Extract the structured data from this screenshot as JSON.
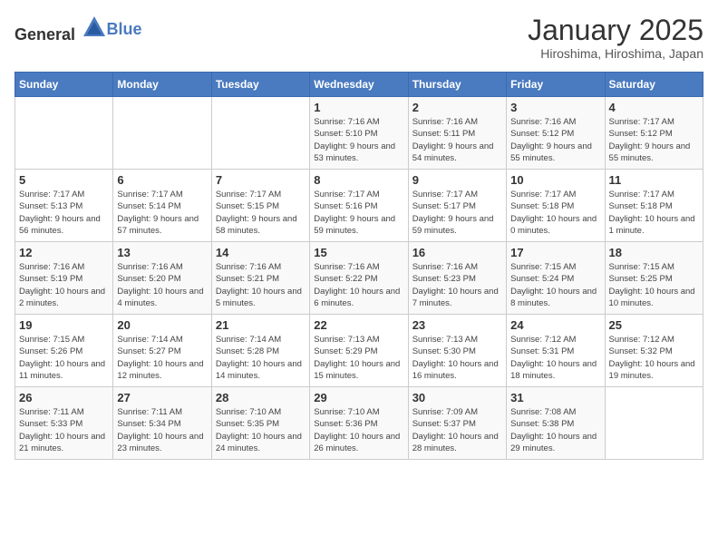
{
  "header": {
    "logo_general": "General",
    "logo_blue": "Blue",
    "month": "January 2025",
    "location": "Hiroshima, Hiroshima, Japan"
  },
  "days_of_week": [
    "Sunday",
    "Monday",
    "Tuesday",
    "Wednesday",
    "Thursday",
    "Friday",
    "Saturday"
  ],
  "weeks": [
    [
      {
        "num": "",
        "detail": ""
      },
      {
        "num": "",
        "detail": ""
      },
      {
        "num": "",
        "detail": ""
      },
      {
        "num": "1",
        "detail": "Sunrise: 7:16 AM\nSunset: 5:10 PM\nDaylight: 9 hours and 53 minutes."
      },
      {
        "num": "2",
        "detail": "Sunrise: 7:16 AM\nSunset: 5:11 PM\nDaylight: 9 hours and 54 minutes."
      },
      {
        "num": "3",
        "detail": "Sunrise: 7:16 AM\nSunset: 5:12 PM\nDaylight: 9 hours and 55 minutes."
      },
      {
        "num": "4",
        "detail": "Sunrise: 7:17 AM\nSunset: 5:12 PM\nDaylight: 9 hours and 55 minutes."
      }
    ],
    [
      {
        "num": "5",
        "detail": "Sunrise: 7:17 AM\nSunset: 5:13 PM\nDaylight: 9 hours and 56 minutes."
      },
      {
        "num": "6",
        "detail": "Sunrise: 7:17 AM\nSunset: 5:14 PM\nDaylight: 9 hours and 57 minutes."
      },
      {
        "num": "7",
        "detail": "Sunrise: 7:17 AM\nSunset: 5:15 PM\nDaylight: 9 hours and 58 minutes."
      },
      {
        "num": "8",
        "detail": "Sunrise: 7:17 AM\nSunset: 5:16 PM\nDaylight: 9 hours and 59 minutes."
      },
      {
        "num": "9",
        "detail": "Sunrise: 7:17 AM\nSunset: 5:17 PM\nDaylight: 9 hours and 59 minutes."
      },
      {
        "num": "10",
        "detail": "Sunrise: 7:17 AM\nSunset: 5:18 PM\nDaylight: 10 hours and 0 minutes."
      },
      {
        "num": "11",
        "detail": "Sunrise: 7:17 AM\nSunset: 5:18 PM\nDaylight: 10 hours and 1 minute."
      }
    ],
    [
      {
        "num": "12",
        "detail": "Sunrise: 7:16 AM\nSunset: 5:19 PM\nDaylight: 10 hours and 2 minutes."
      },
      {
        "num": "13",
        "detail": "Sunrise: 7:16 AM\nSunset: 5:20 PM\nDaylight: 10 hours and 4 minutes."
      },
      {
        "num": "14",
        "detail": "Sunrise: 7:16 AM\nSunset: 5:21 PM\nDaylight: 10 hours and 5 minutes."
      },
      {
        "num": "15",
        "detail": "Sunrise: 7:16 AM\nSunset: 5:22 PM\nDaylight: 10 hours and 6 minutes."
      },
      {
        "num": "16",
        "detail": "Sunrise: 7:16 AM\nSunset: 5:23 PM\nDaylight: 10 hours and 7 minutes."
      },
      {
        "num": "17",
        "detail": "Sunrise: 7:15 AM\nSunset: 5:24 PM\nDaylight: 10 hours and 8 minutes."
      },
      {
        "num": "18",
        "detail": "Sunrise: 7:15 AM\nSunset: 5:25 PM\nDaylight: 10 hours and 10 minutes."
      }
    ],
    [
      {
        "num": "19",
        "detail": "Sunrise: 7:15 AM\nSunset: 5:26 PM\nDaylight: 10 hours and 11 minutes."
      },
      {
        "num": "20",
        "detail": "Sunrise: 7:14 AM\nSunset: 5:27 PM\nDaylight: 10 hours and 12 minutes."
      },
      {
        "num": "21",
        "detail": "Sunrise: 7:14 AM\nSunset: 5:28 PM\nDaylight: 10 hours and 14 minutes."
      },
      {
        "num": "22",
        "detail": "Sunrise: 7:13 AM\nSunset: 5:29 PM\nDaylight: 10 hours and 15 minutes."
      },
      {
        "num": "23",
        "detail": "Sunrise: 7:13 AM\nSunset: 5:30 PM\nDaylight: 10 hours and 16 minutes."
      },
      {
        "num": "24",
        "detail": "Sunrise: 7:12 AM\nSunset: 5:31 PM\nDaylight: 10 hours and 18 minutes."
      },
      {
        "num": "25",
        "detail": "Sunrise: 7:12 AM\nSunset: 5:32 PM\nDaylight: 10 hours and 19 minutes."
      }
    ],
    [
      {
        "num": "26",
        "detail": "Sunrise: 7:11 AM\nSunset: 5:33 PM\nDaylight: 10 hours and 21 minutes."
      },
      {
        "num": "27",
        "detail": "Sunrise: 7:11 AM\nSunset: 5:34 PM\nDaylight: 10 hours and 23 minutes."
      },
      {
        "num": "28",
        "detail": "Sunrise: 7:10 AM\nSunset: 5:35 PM\nDaylight: 10 hours and 24 minutes."
      },
      {
        "num": "29",
        "detail": "Sunrise: 7:10 AM\nSunset: 5:36 PM\nDaylight: 10 hours and 26 minutes."
      },
      {
        "num": "30",
        "detail": "Sunrise: 7:09 AM\nSunset: 5:37 PM\nDaylight: 10 hours and 28 minutes."
      },
      {
        "num": "31",
        "detail": "Sunrise: 7:08 AM\nSunset: 5:38 PM\nDaylight: 10 hours and 29 minutes."
      },
      {
        "num": "",
        "detail": ""
      }
    ]
  ]
}
